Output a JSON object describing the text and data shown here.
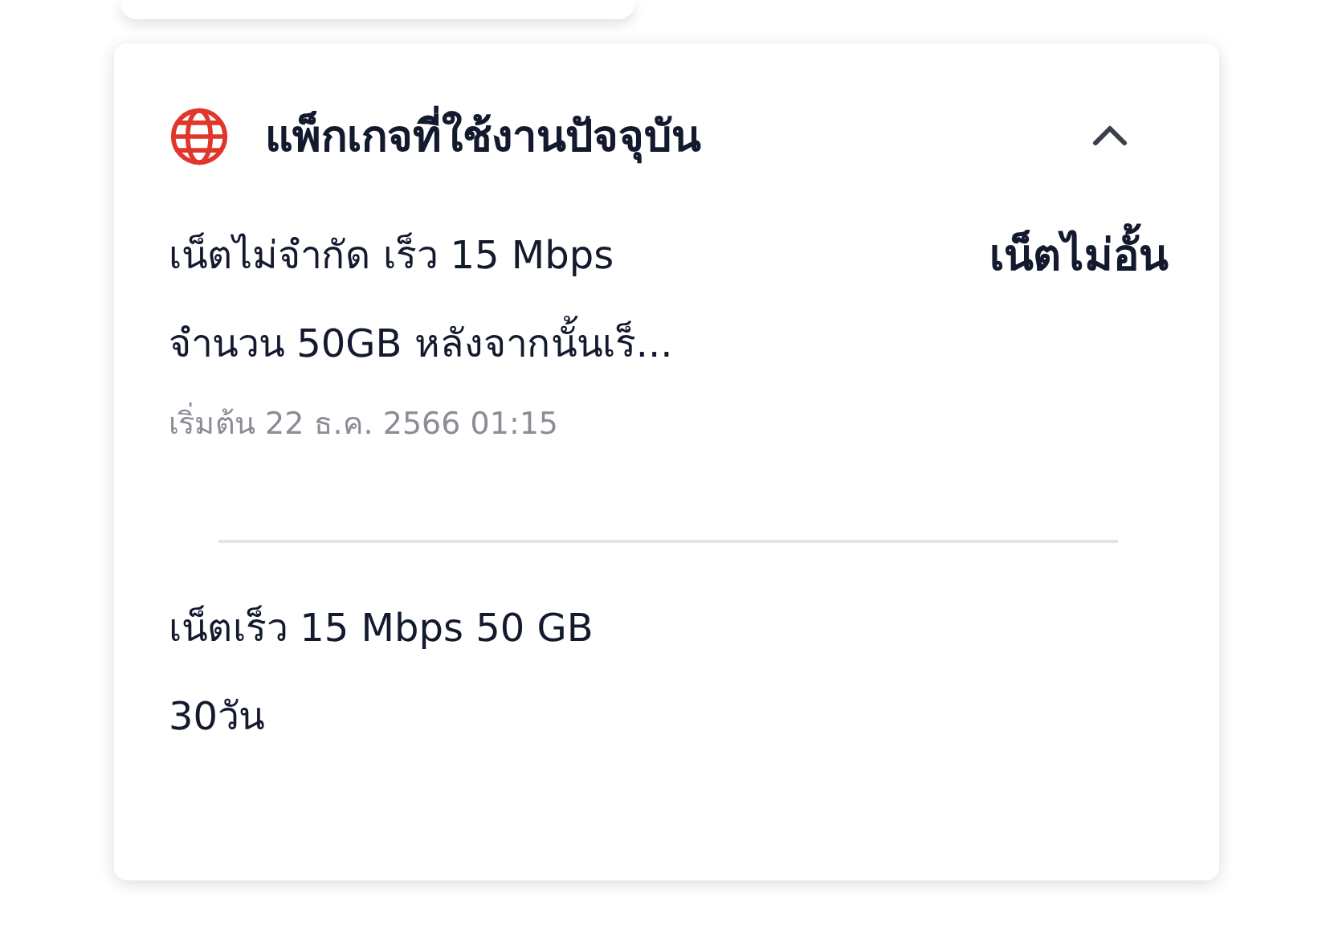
{
  "package_card": {
    "title": "แพ็กเกจที่ใช้งานปัจจุบัน",
    "expanded": true,
    "package_name": "เน็ตไม่จำกัด เร็ว 15 Mbps",
    "package_detail": "จำนวน 50GB หลังจากนั้นเร็...",
    "badge": "เน็ตไม่อั้น",
    "start_date": "เริ่มต้น 22 ธ.ค. 2566 01:15",
    "details": [
      "เน็ตเร็ว 15 Mbps 50 GB",
      "30วัน"
    ]
  }
}
